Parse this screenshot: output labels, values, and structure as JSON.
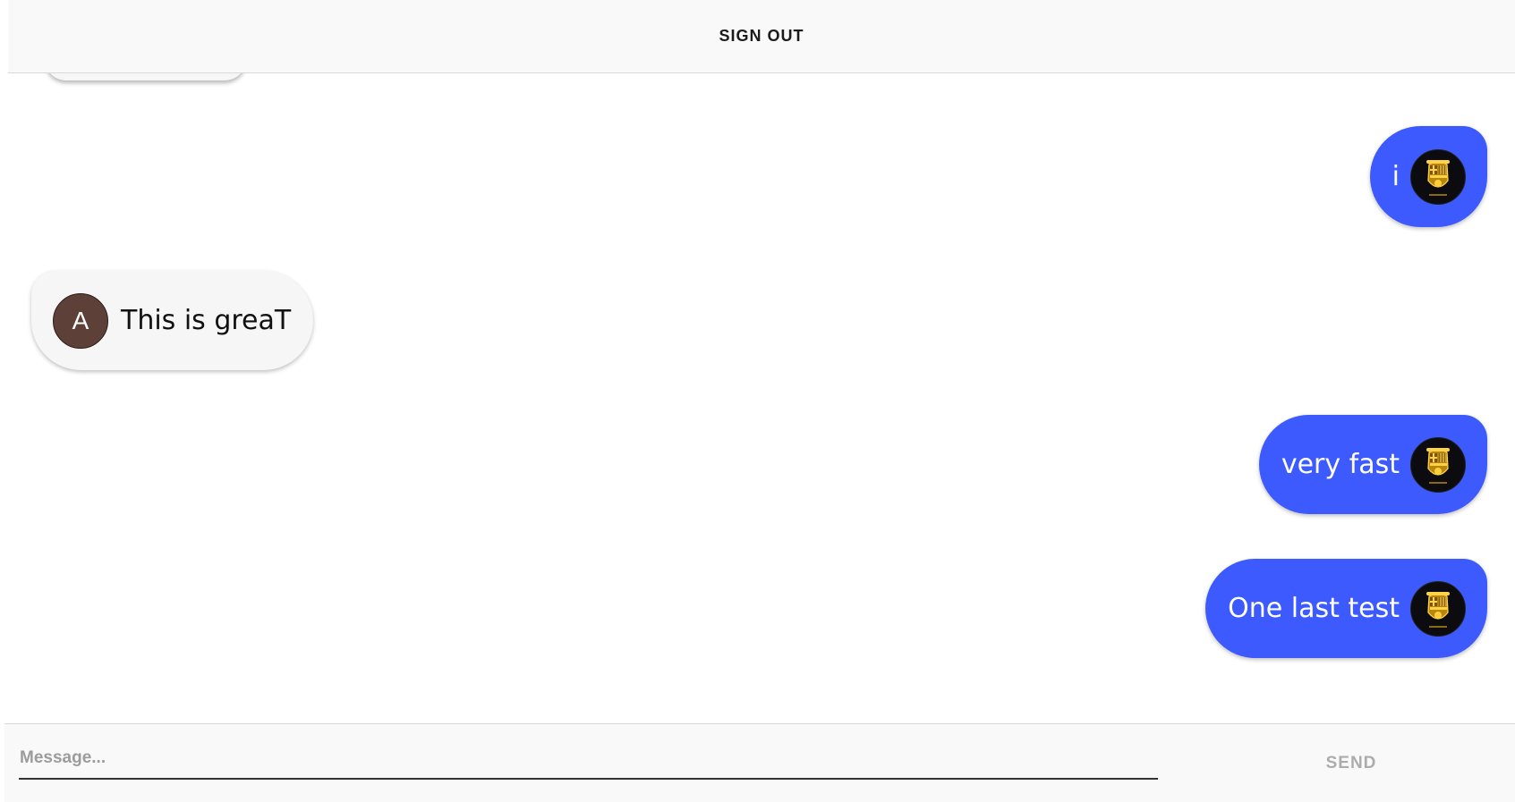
{
  "header": {
    "signout_label": "SIGN OUT"
  },
  "messages": [
    {
      "text": "i",
      "sender": "me",
      "avatar_icon": "barcelona-crest-icon"
    },
    {
      "text": "This is greaT",
      "sender": "other",
      "avatar_letter": "A"
    },
    {
      "text": "very fast",
      "sender": "me",
      "avatar_icon": "barcelona-crest-icon"
    },
    {
      "text": "One last test",
      "sender": "me",
      "avatar_icon": "barcelona-crest-icon"
    }
  ],
  "composer": {
    "placeholder": "Message...",
    "value": "",
    "send_label": "SEND"
  },
  "colors": {
    "sent_bubble": "#3d5afe",
    "received_bubble": "#f6f6f6",
    "letter_avatar": "#5d4037",
    "crest_gold": "#d4a017"
  }
}
